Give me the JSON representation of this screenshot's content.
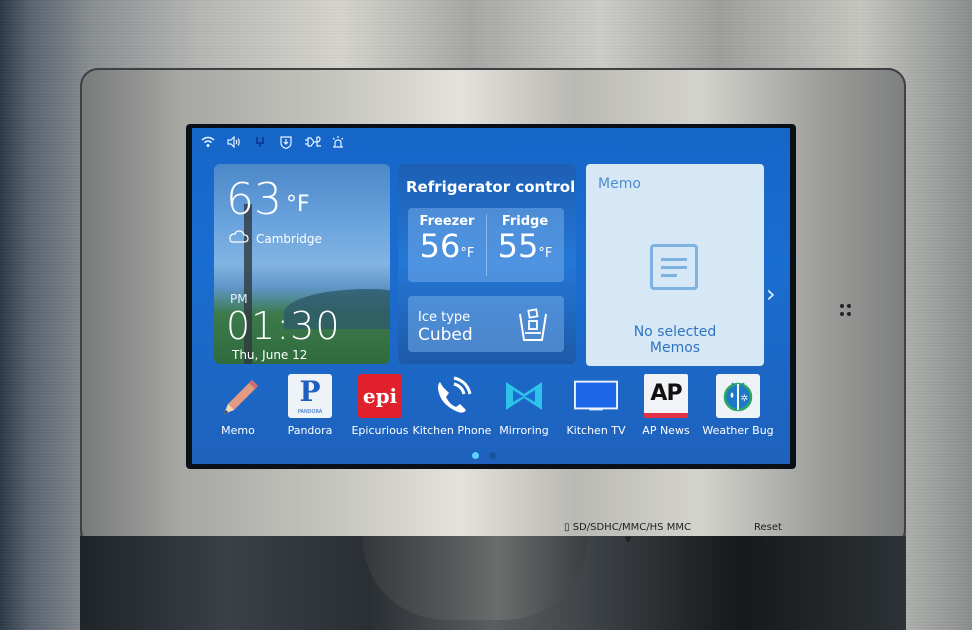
{
  "status_bar": {
    "icons": [
      "wifi-icon",
      "volume-icon",
      "network-icon",
      "shield-download-icon",
      "cable-icon",
      "alarm-icon"
    ]
  },
  "weather_widget": {
    "temperature": "63",
    "unit": "°F",
    "weather_icon": "cloudy-icon",
    "city": "Cambridge",
    "ampm": "PM",
    "time": "01:30",
    "date": "Thu, June 12"
  },
  "fridge_control": {
    "title": "Refrigerator control",
    "freezer_label": "Freezer",
    "freezer_temp": "56",
    "fridge_label": "Fridge",
    "fridge_temp": "55",
    "unit": "°F",
    "ice_label": "Ice type",
    "ice_value": "Cubed"
  },
  "memo_widget": {
    "title": "Memo",
    "empty_line1": "No selected",
    "empty_line2": "Memos"
  },
  "next_arrow": "›",
  "apps": [
    {
      "label": "Memo",
      "icon": "pencil-icon"
    },
    {
      "label": "Pandora",
      "icon": "pandora-icon",
      "glyph": "P",
      "sub": "PANDORA"
    },
    {
      "label": "Epicurious",
      "icon": "epicurious-icon",
      "glyph": "epi"
    },
    {
      "label": "Kitchen Phone",
      "icon": "phone-icon"
    },
    {
      "label": "Mirroring",
      "icon": "mirroring-icon"
    },
    {
      "label": "Kitchen TV",
      "icon": "tv-icon"
    },
    {
      "label": "AP News",
      "icon": "ap-news-icon",
      "glyph": "AP"
    },
    {
      "label": "Weather Bug",
      "icon": "weatherbug-icon"
    }
  ],
  "page_indicator": {
    "current": 1,
    "total": 2
  },
  "bezel": {
    "sd_label": "SD/SDHC/MMC/HS MMC",
    "reset_label": "Reset"
  },
  "colors": {
    "screen_blue": "#1a6dd0",
    "memo_bg": "#d6e8f6",
    "accent_cyan": "#5dd0ff",
    "epicurious_red": "#e0202a"
  }
}
